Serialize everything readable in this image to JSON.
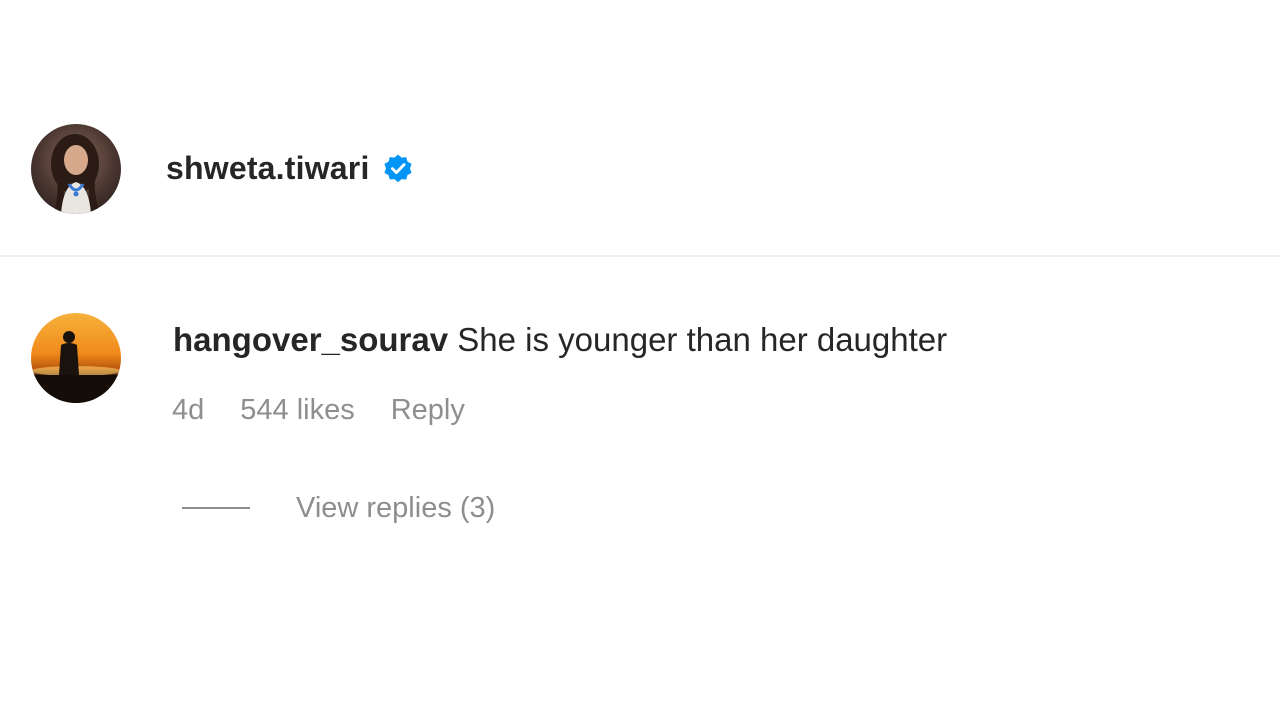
{
  "post": {
    "author": {
      "username": "shweta.tiwari",
      "verified": true,
      "avatar_icon": "profile-photo-avatar",
      "verified_icon": "verified-badge-icon"
    }
  },
  "comments": [
    {
      "username": "hangover_sourav",
      "text": " She is younger than her daughter",
      "avatar_icon": "sunset-silhouette-avatar",
      "time": "4d",
      "likes": "544 likes",
      "reply_label": "Reply",
      "view_replies_label": "View replies (3)"
    }
  ],
  "colors": {
    "primary_text": "#262626",
    "secondary_text": "#8e8e8e",
    "verified_blue": "#0095f6",
    "divider": "#efefef"
  }
}
